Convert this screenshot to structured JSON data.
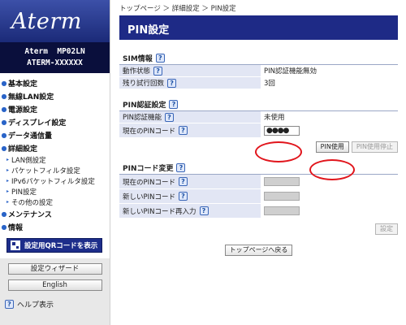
{
  "sidebar": {
    "logo": "Aterm",
    "model_line1": "Aterm  MP02LN",
    "model_line2": "ATERM-XXXXXX",
    "nav": [
      {
        "label": "基本設定"
      },
      {
        "label": "無線LAN設定"
      },
      {
        "label": "電源設定"
      },
      {
        "label": "ディスプレイ設定"
      },
      {
        "label": "データ通信量"
      },
      {
        "label": "詳細設定"
      }
    ],
    "sub_items": [
      {
        "label": "LAN側設定"
      },
      {
        "label": "パケットフィルタ設定"
      },
      {
        "label": "IPv6パケットフィルタ設定"
      },
      {
        "label": "PIN設定"
      },
      {
        "label": "その他の設定"
      }
    ],
    "nav_after": [
      {
        "label": "メンテナンス"
      },
      {
        "label": "情報"
      }
    ],
    "qr_button": "設定用QRコードを表示",
    "wizard_button": "設定ウィザード",
    "english_button": "English",
    "help_label": "ヘルプ表示"
  },
  "breadcrumb": "トップページ ＞ 詳細設定 ＞ PIN設定",
  "page_title": "PIN設定",
  "sim_info": {
    "heading": "SIM情報",
    "rows": [
      {
        "label": "動作状態",
        "value": "PIN認証機能無効"
      },
      {
        "label": "残り試行回数",
        "value": "3回"
      }
    ]
  },
  "pin_auth": {
    "heading": "PIN認証設定",
    "function_label": "PIN認証機能",
    "function_value": "未使用",
    "current_pin_label": "現在のPINコード",
    "current_pin_value": "●●●●",
    "use_button": "PIN使用",
    "stop_button": "PIN使用停止"
  },
  "pin_change": {
    "heading": "PINコード変更",
    "rows": [
      {
        "label": "現在のPINコード"
      },
      {
        "label": "新しいPINコード"
      },
      {
        "label": "新しいPINコード再入力"
      }
    ],
    "set_button": "設定"
  },
  "back_button": "トップページへ戻る",
  "colors": {
    "title_bar": "#1e2a86",
    "label_bg": "#e2e6f4",
    "highlight_ring": "#e1151c"
  }
}
